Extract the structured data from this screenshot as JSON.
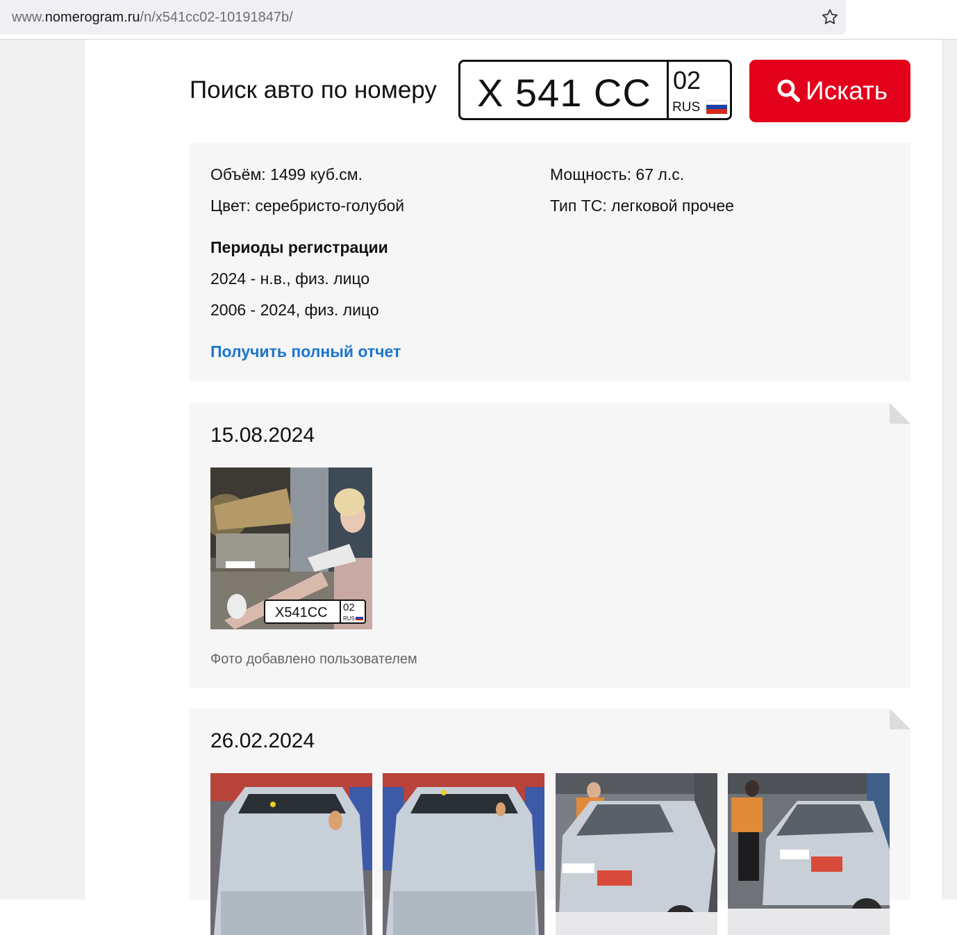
{
  "browser": {
    "url_prefix": "www.",
    "url_host": "nomerogram.ru",
    "url_path": "/n/x541cc02-10191847b/",
    "bookmark_icon": "star-icon"
  },
  "search": {
    "title": "Поиск авто по номеру",
    "plate_number": "Х 541 СС",
    "region_code": "02",
    "country": "RUS",
    "button_label": "Искать",
    "button_icon": "search-icon",
    "accent_color": "#e3001b"
  },
  "info": {
    "volume": "Объём: 1499 куб.см.",
    "power": "Мощность: 67 л.с.",
    "color": "Цвет: серебристо-голубой",
    "vehicle_type": "Тип ТС: легковой прочее",
    "periods_heading": "Периоды регистрации",
    "periods": [
      "2024 - н.в., физ. лицо",
      "2006 - 2024, физ. лицо"
    ],
    "report_link": "Получить полный отчет",
    "link_color": "#1a75cd"
  },
  "entries": [
    {
      "date": "15.08.2024",
      "caption": "Фото добавлено пользователем",
      "photo_plate": {
        "number": "Х541СС",
        "region": "02",
        "country": "RUS"
      }
    },
    {
      "date": "26.02.2024"
    }
  ]
}
